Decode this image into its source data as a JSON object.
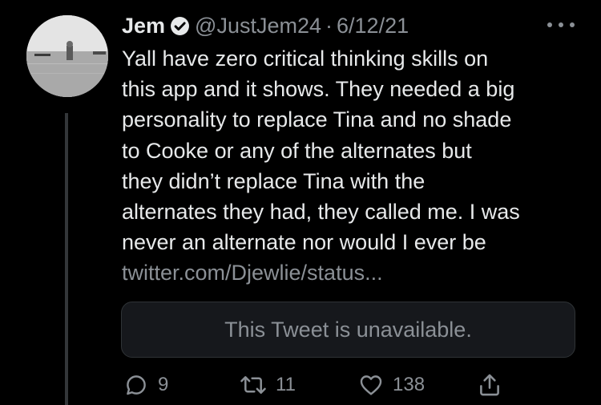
{
  "tweet": {
    "author": {
      "name": "Jem",
      "handle": "@JustJem24",
      "verified": true,
      "avatar_icon": "avatar-photo-icon"
    },
    "separator": "·",
    "date": "6/12/21",
    "text_lines": [
      "Yall have zero critical thinking skills on",
      "this app and it shows. They needed a big",
      "personality to replace Tina and no shade",
      "to Cooke or any of the alternates but",
      "they didn’t replace Tina with the",
      "alternates they had, they called me. I was",
      "never an alternate nor would I ever be"
    ],
    "link_text": "twitter.com/Djewlie/status...",
    "quoted_tweet": {
      "message": "This Tweet is unavailable."
    },
    "actions": {
      "reply_count": "9",
      "retweet_count": "11",
      "like_count": "138"
    }
  },
  "colors": {
    "background": "#000000",
    "primary_text": "#e7e9ea",
    "secondary_text": "#8b9096",
    "quote_background": "#16181c",
    "thread_line": "#333639"
  }
}
